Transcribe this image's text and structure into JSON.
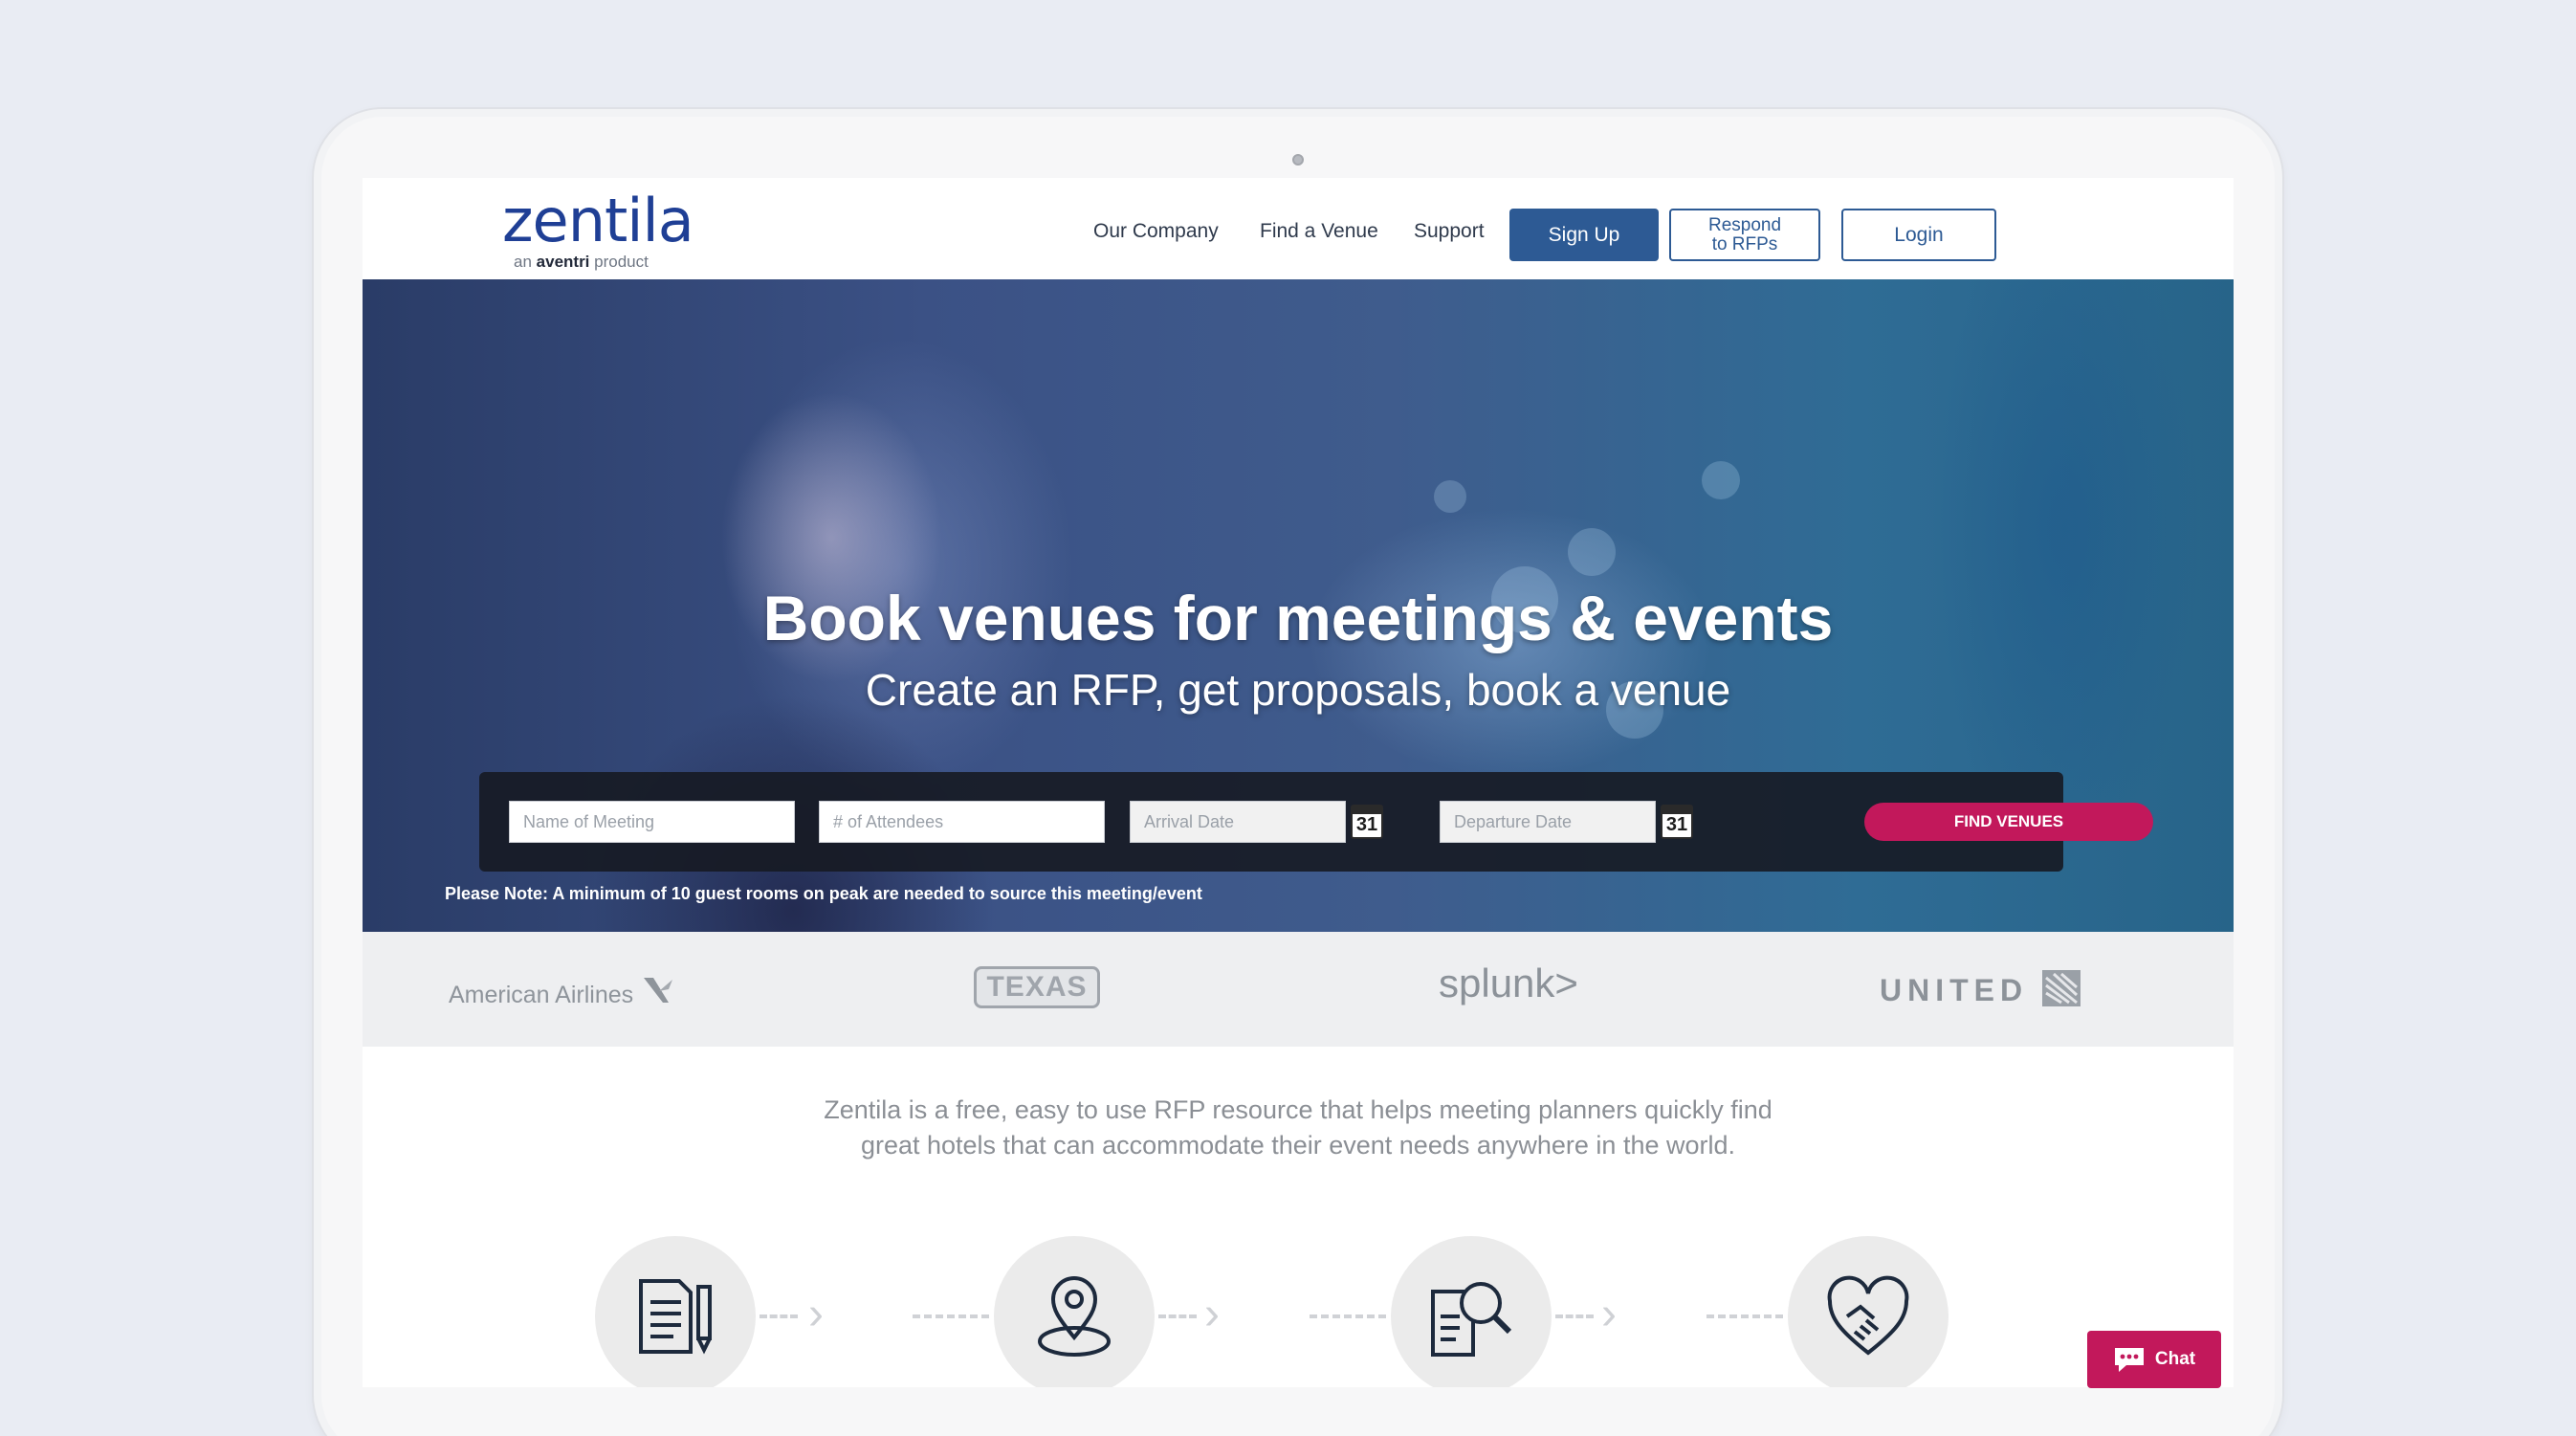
{
  "brand": {
    "name": "zentila",
    "tagline_prefix": "an",
    "tagline_brand": "aventri",
    "tagline_suffix": "product"
  },
  "nav": {
    "items": [
      "Our Company",
      "Find a Venue",
      "Support"
    ]
  },
  "header_buttons": {
    "signup": "Sign Up",
    "respond_line1": "Respond",
    "respond_line2": "to RFPs",
    "login": "Login"
  },
  "hero": {
    "title": "Book venues for meetings & events",
    "subtitle": "Create an RFP, get proposals, book a venue"
  },
  "search": {
    "meeting_placeholder": "Name of Meeting",
    "attendees_placeholder": "# of Attendees",
    "arrival_placeholder": "Arrival Date",
    "departure_placeholder": "Departure Date",
    "calendar_day": "31",
    "find_label": "FIND VENUES"
  },
  "note": "Please Note: A minimum of 10 guest rooms on peak are needed to source this meeting/event",
  "clients": {
    "aa": "American Airlines",
    "texas": "TEXAS",
    "splunk": "splunk>",
    "united": "UNITED"
  },
  "description": {
    "line1": "Zentila is a free, easy to use RFP resource that helps meeting planners quickly find",
    "line2": "great hotels that can accommodate their event needs anywhere in the world."
  },
  "steps": [
    {
      "icon": "document-pen-icon"
    },
    {
      "icon": "location-pin-icon"
    },
    {
      "icon": "document-search-icon"
    },
    {
      "icon": "handshake-heart-icon"
    }
  ],
  "chat": {
    "label": "Chat"
  },
  "colors": {
    "primary": "#2d5a94",
    "accent": "#c2185b",
    "logo": "#1f3f95"
  }
}
